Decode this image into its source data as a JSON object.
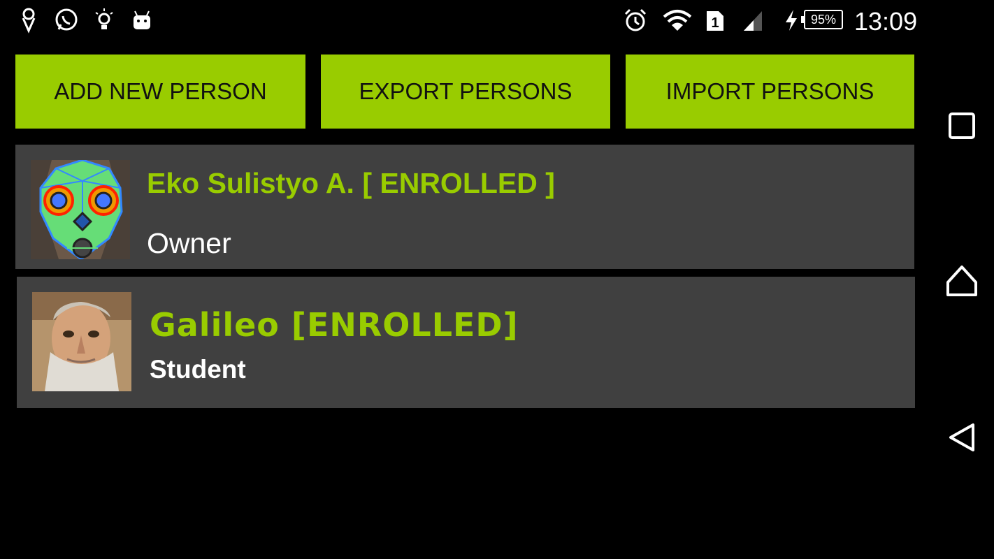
{
  "status_bar": {
    "left_icons": [
      "ice-cream-icon",
      "whatsapp-icon",
      "lightbulb-icon",
      "android-icon"
    ],
    "right_icons": [
      "alarm-icon",
      "wifi-icon",
      "sim-icon",
      "signal-icon",
      "charging-icon"
    ],
    "sim_number": "1",
    "battery": "95%",
    "time": "13:09"
  },
  "toolbar": {
    "add_label": "ADD NEW PERSON",
    "export_label": "EXPORT PERSONS",
    "import_label": "IMPORT PERSONS"
  },
  "persons": [
    {
      "name": "Eko Sulistyo A. [ ENROLLED ]",
      "role": "Owner",
      "avatar": "face-mesh-avatar"
    },
    {
      "name": "Galileo [ENROLLED]",
      "role": "Student",
      "avatar": "galileo-portrait"
    }
  ],
  "nav": [
    "recents-icon",
    "home-icon",
    "back-icon"
  ],
  "colors": {
    "accent": "#99cc00",
    "row_bg": "#404040",
    "background": "#000000"
  }
}
